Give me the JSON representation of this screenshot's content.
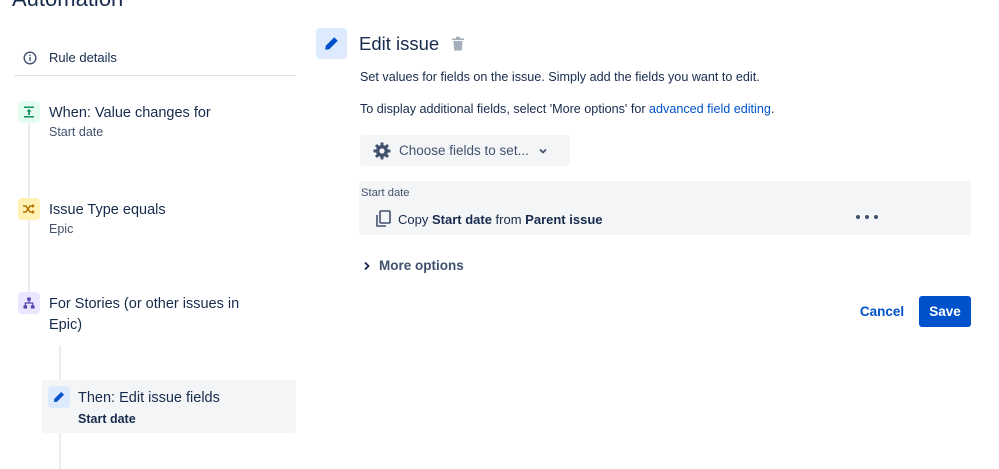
{
  "page": {
    "title": "Automation"
  },
  "sidebar": {
    "rule_details_label": "Rule details",
    "steps": [
      {
        "title": "When: Value changes for",
        "subtitle": "Start date",
        "icon": "trigger-icon",
        "color": "#00875a"
      },
      {
        "title": "Issue Type equals",
        "subtitle": "Epic",
        "icon": "condition-shuffle-icon",
        "color": "#ff8b00"
      },
      {
        "title": "For Stories (or other issues in Epic)",
        "icon": "branch-hierarchy-icon",
        "color": "#5243aa"
      },
      {
        "title": "Then: Edit issue fields",
        "subtitle": "Start date",
        "icon": "pencil-icon",
        "color": "#0052cc"
      }
    ]
  },
  "main": {
    "title": "Edit issue",
    "description": "Set values for fields on the issue. Simply add the fields you want to edit.",
    "advanced_prefix": "To display additional fields, select 'More options' for ",
    "advanced_link": "advanced field editing",
    "advanced_suffix": ".",
    "choose_fields_label": "Choose fields to set...",
    "field": {
      "label": "Start date",
      "prefix": "Copy ",
      "field_name": "Start date",
      "middle": " from ",
      "source": "Parent issue"
    },
    "more_options_label": "More options",
    "cancel_label": "Cancel",
    "save_label": "Save"
  },
  "colors": {
    "accent": "#0052cc",
    "text": "#172b4d",
    "subtle": "#42526e",
    "panel": "#f4f5f7"
  }
}
